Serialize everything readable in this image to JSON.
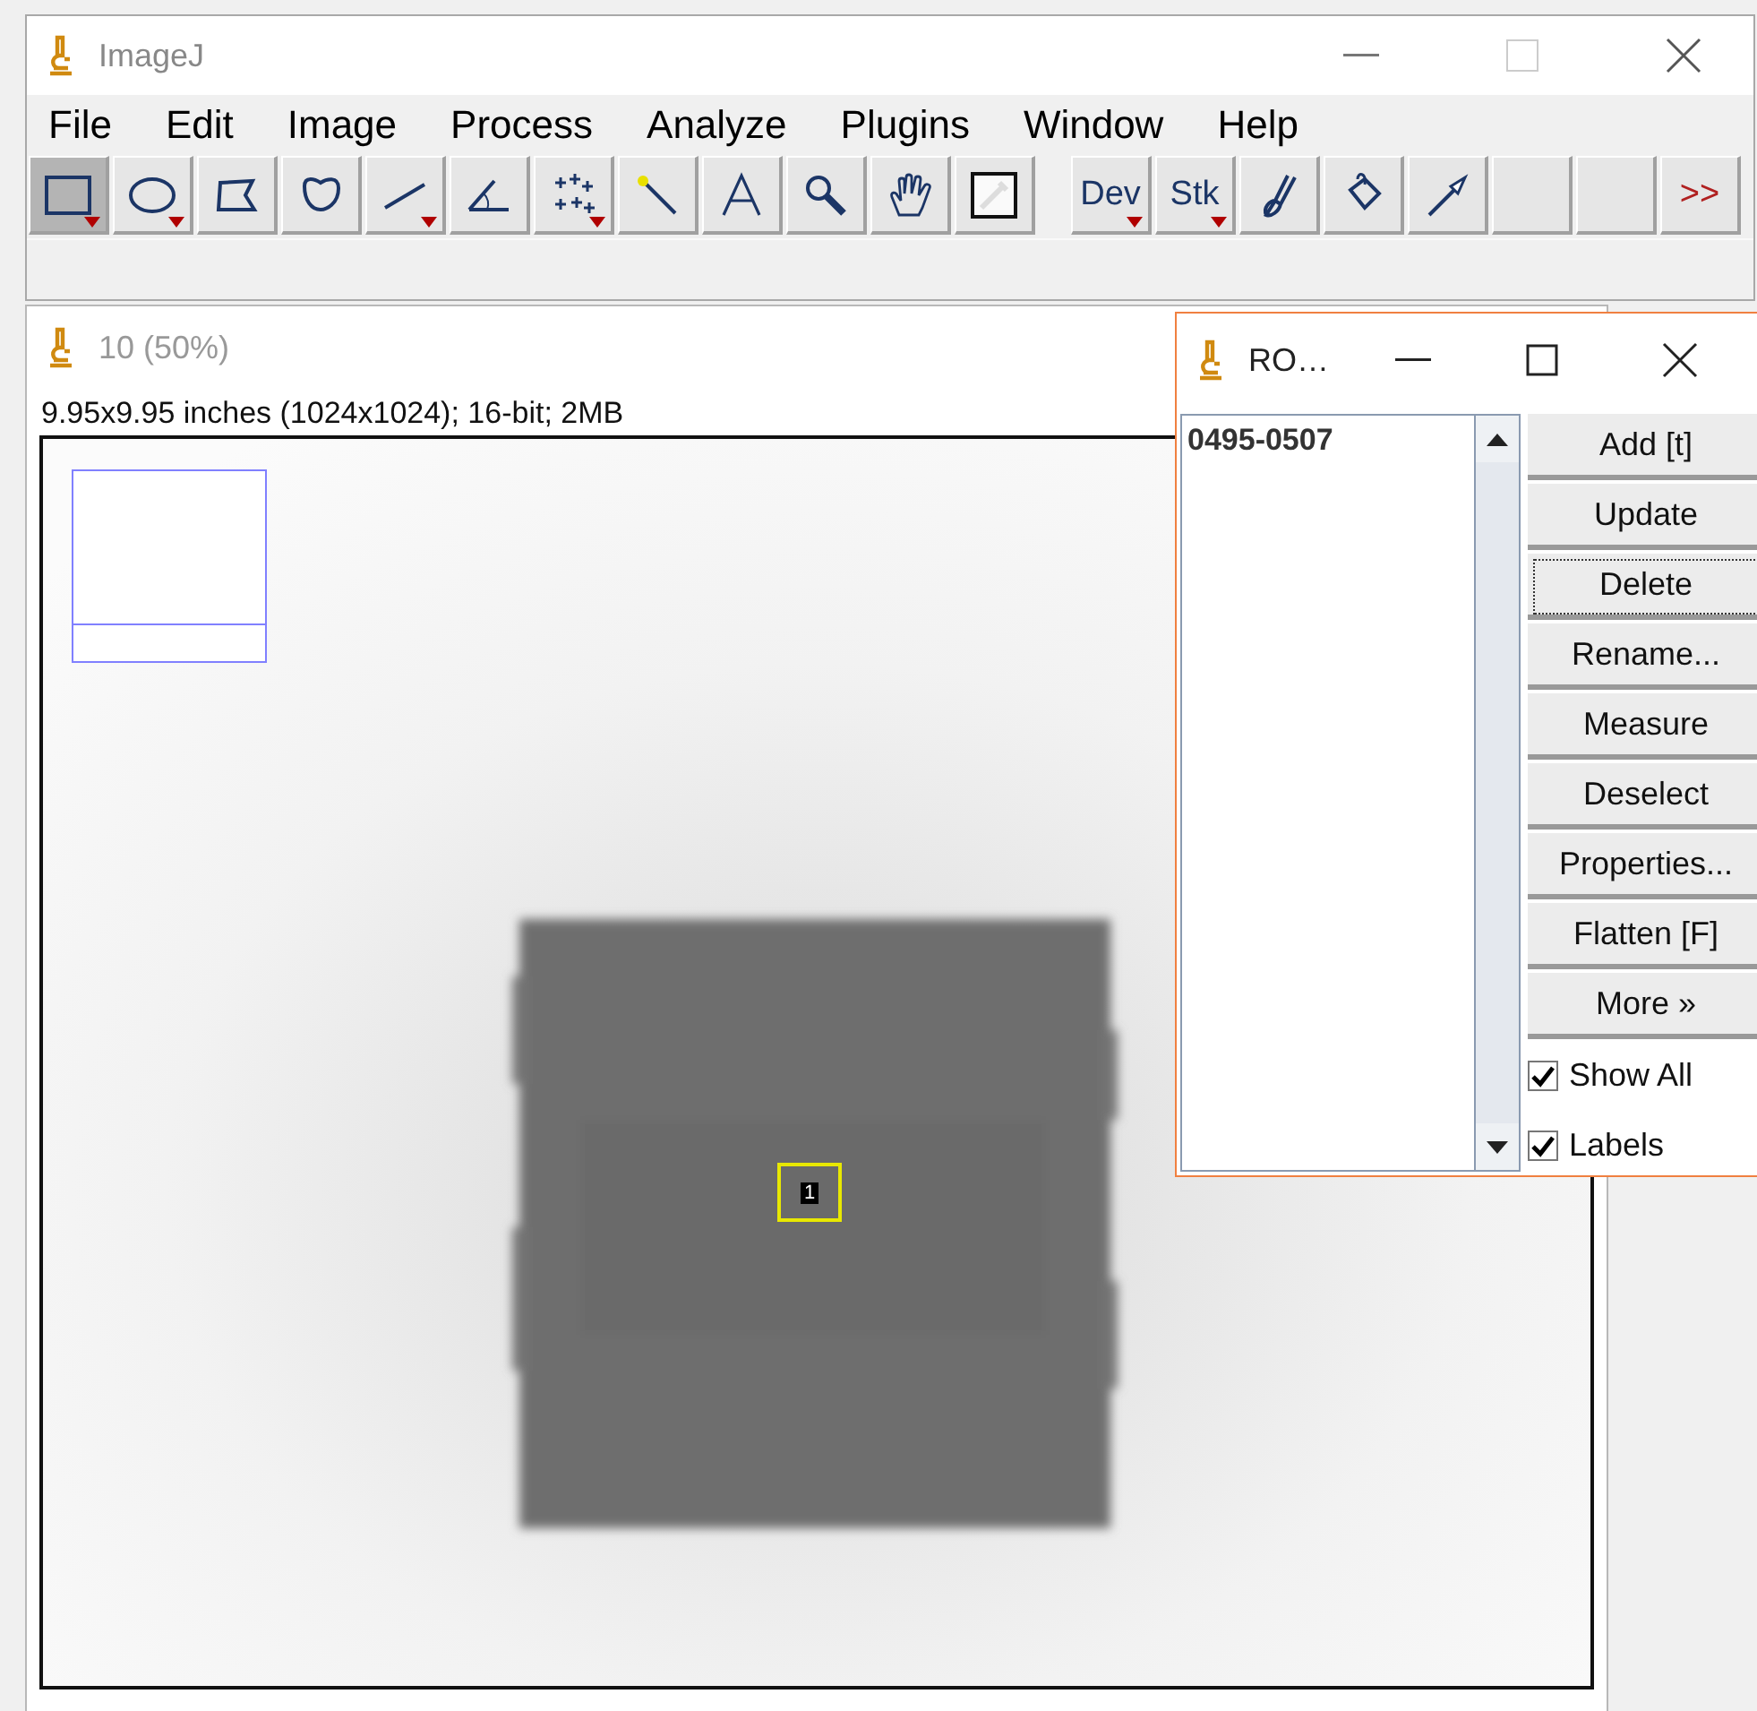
{
  "main_window": {
    "title": "ImageJ",
    "menu": [
      "File",
      "Edit",
      "Image",
      "Process",
      "Analyze",
      "Plugins",
      "Window",
      "Help"
    ],
    "tools": [
      {
        "kind": "rectangle",
        "menu": true,
        "selected": true
      },
      {
        "kind": "oval",
        "menu": true,
        "selected": false
      },
      {
        "kind": "polygon",
        "menu": false,
        "selected": false
      },
      {
        "kind": "freehand",
        "menu": false,
        "selected": false
      },
      {
        "kind": "line",
        "menu": true,
        "selected": false
      },
      {
        "kind": "angle",
        "menu": false,
        "selected": false
      },
      {
        "kind": "point",
        "menu": true,
        "selected": false
      },
      {
        "kind": "wand",
        "menu": false,
        "selected": false
      },
      {
        "kind": "text",
        "menu": false,
        "selected": false
      },
      {
        "kind": "magnifier",
        "menu": false,
        "selected": false
      },
      {
        "kind": "hand",
        "menu": false,
        "selected": false
      },
      {
        "kind": "dropper",
        "menu": false,
        "selected": false
      }
    ],
    "plugin_tools": [
      {
        "kind": "label",
        "label": "Dev",
        "menu": true
      },
      {
        "kind": "label",
        "label": "Stk",
        "menu": true
      },
      {
        "kind": "brush",
        "menu": false
      },
      {
        "kind": "bucket",
        "menu": false
      },
      {
        "kind": "arrow",
        "menu": false
      },
      {
        "kind": "blank",
        "menu": false
      },
      {
        "kind": "blank",
        "menu": false
      },
      {
        "kind": "more",
        "label": ">>",
        "menu": false
      }
    ]
  },
  "image_window": {
    "title": "10 (50%)",
    "info": "9.95x9.95 inches (1024x1024); 16-bit; 2MB",
    "roi_label": "1"
  },
  "roi_manager": {
    "title": "RO…",
    "items": [
      {
        "label": "0495-0507",
        "selected": false
      }
    ],
    "buttons": [
      {
        "label": "Add [t]",
        "focused": false
      },
      {
        "label": "Update",
        "focused": false
      },
      {
        "label": "Delete",
        "focused": true
      },
      {
        "label": "Rename...",
        "focused": false
      },
      {
        "label": "Measure",
        "focused": false
      },
      {
        "label": "Deselect",
        "focused": false
      },
      {
        "label": "Properties...",
        "focused": false
      },
      {
        "label": "Flatten [F]",
        "focused": false
      },
      {
        "label": "More »",
        "focused": false
      }
    ],
    "checkboxes": [
      {
        "label": "Show All",
        "checked": true
      },
      {
        "label": "Labels",
        "checked": true
      }
    ]
  }
}
